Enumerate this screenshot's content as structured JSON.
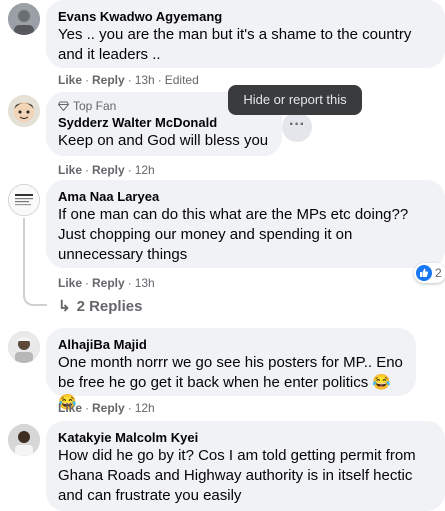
{
  "comments": [
    {
      "name": "Evans Kwadwo Agyemang",
      "text": "Yes .. you are the man but it's a shame to the country and it leaders ..",
      "like": "Like",
      "reply": "Reply",
      "time": "13h",
      "edited": "Edited"
    },
    {
      "badge": "Top Fan",
      "name": "Sydderz Walter McDonald",
      "text": "Keep on and God will bless you",
      "like": "Like",
      "reply": "Reply",
      "time": "12h"
    },
    {
      "name": "Ama Naa Laryea",
      "text": "If one man can do this what are the MPs etc doing?? Just chopping our money and spending it on unnecessary things",
      "like": "Like",
      "reply": "Reply",
      "time": "13h",
      "reaction_count": "2",
      "replies": "2 Replies"
    },
    {
      "name": "AlhajiBa Majid",
      "text": "One month norrr we go see his posters for MP.. Eno be free he go get it back when he enter politics 😂😂",
      "like": "Like",
      "reply": "Reply",
      "time": "12h"
    },
    {
      "name": "Katakyie Malcolm Kyei",
      "text": "How did he go by it? Cos I am told getting permit from Ghana Roads and Highway authority is in itself hectic and can frustrate you easily"
    }
  ],
  "tooltip": "Hide or report this",
  "colors": {
    "bubble": "#f0f2f5",
    "muted": "#65676b",
    "like_blue": "#1877f2",
    "tooltip_bg": "#3a3b3c"
  }
}
